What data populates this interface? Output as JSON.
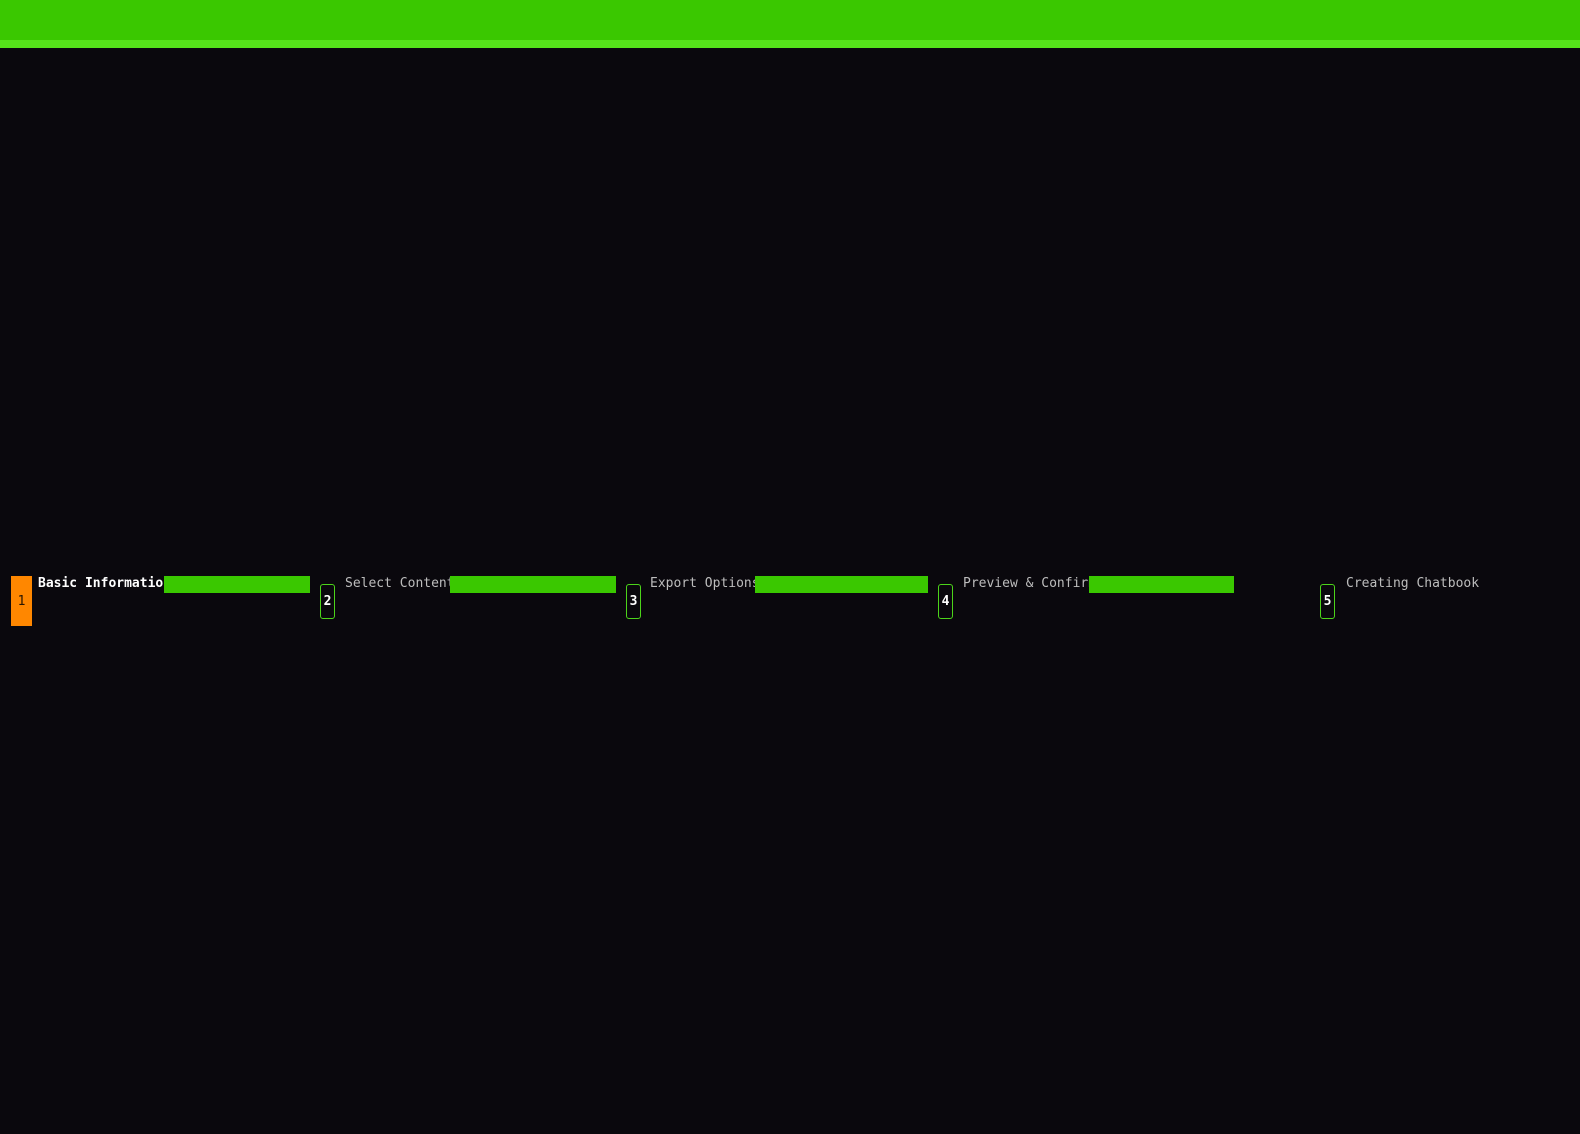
{
  "wizard": {
    "steps": [
      {
        "number": "1",
        "label": "Basic Information",
        "state": "active"
      },
      {
        "number": "2",
        "label": "Select Content",
        "state": "pending"
      },
      {
        "number": "3",
        "label": "Export Options",
        "state": "pending"
      },
      {
        "number": "4",
        "label": "Preview & Confirm",
        "state": "pending"
      },
      {
        "number": "5",
        "label": "Creating Chatbook",
        "state": "pending"
      }
    ]
  },
  "colors": {
    "accent": "#3ac800",
    "accent_light": "#55e21a",
    "active_step": "#ff8700",
    "background": "#0a080d"
  }
}
